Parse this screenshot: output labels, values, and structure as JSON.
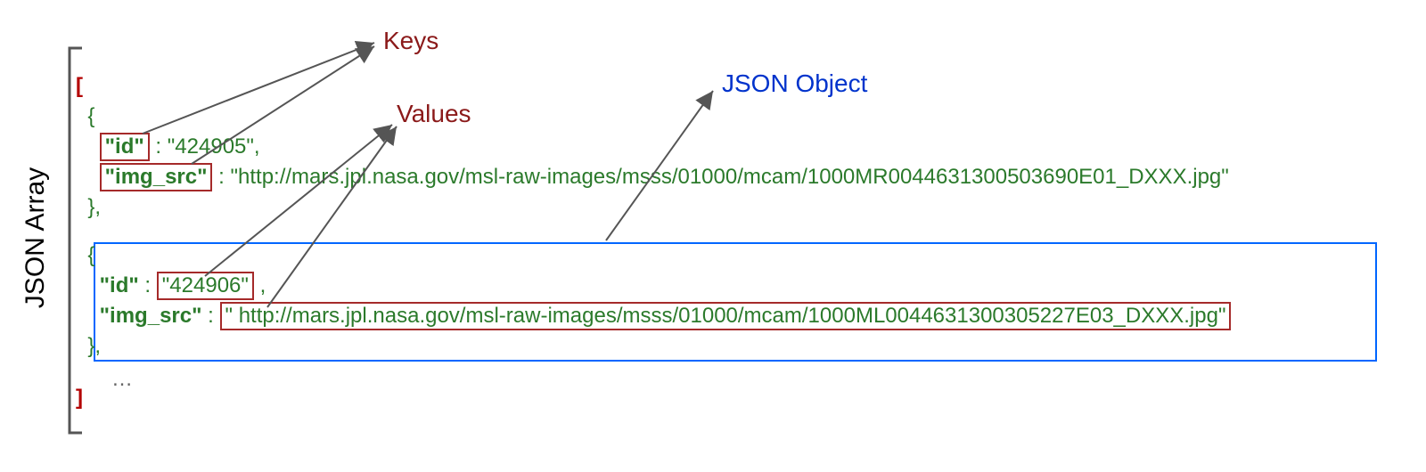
{
  "labels": {
    "json_array": "JSON Array",
    "keys": "Keys",
    "values": "Values",
    "json_object": "JSON Object"
  },
  "open_bracket": "[",
  "close_bracket": "]",
  "brace_open": "{",
  "brace_close_comma": "},",
  "colon": " : ",
  "comma": ",",
  "space": " ",
  "indent1": "  ",
  "indent2": "    ",
  "ellipsis": "…",
  "obj1": {
    "k_id": "\"id\"",
    "v_id": "\"424905\"",
    "k_img": "\"img_src\"",
    "v_img": "\"http://mars.jpl.nasa.gov/msl-raw-images/msss/01000/mcam/1000MR0044631300503690E01_DXXX.jpg\""
  },
  "obj2": {
    "k_id": "\"id\"",
    "v_id": "\"424906\"",
    "k_img": "\"img_src\"",
    "v_img": "\" http://mars.jpl.nasa.gov/msl-raw-images/msss/01000/mcam/1000ML0044631300305227E03_DXXX.jpg\""
  }
}
